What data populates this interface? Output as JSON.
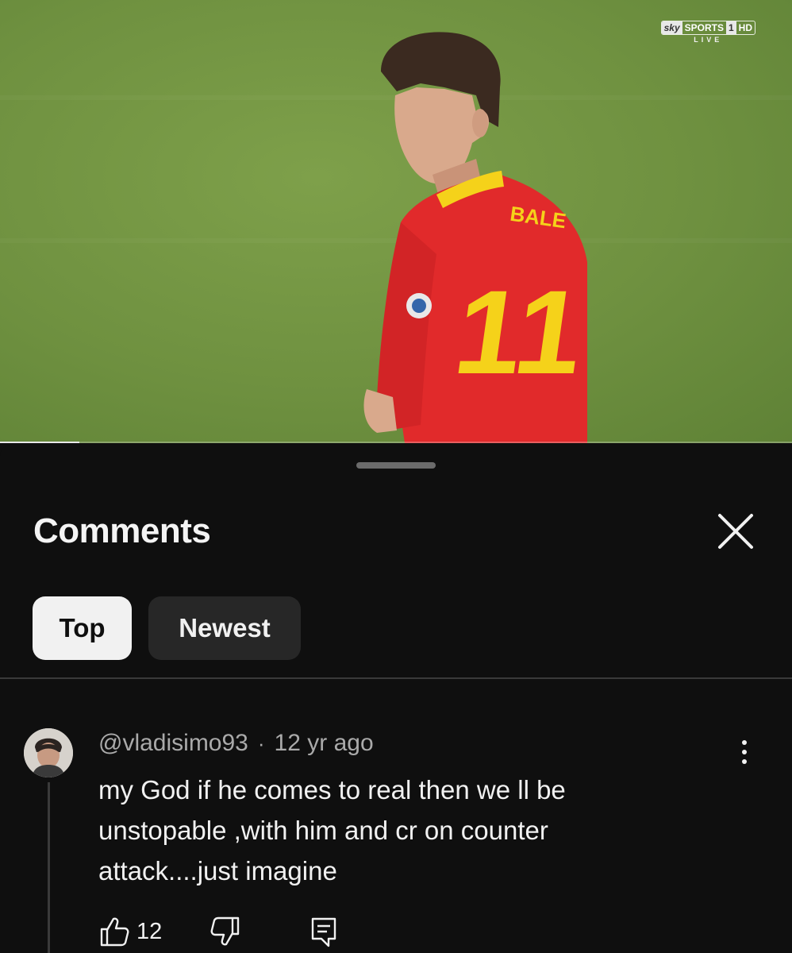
{
  "video": {
    "broadcaster": {
      "sky": "sky",
      "sports": "SPORTS",
      "channel": "1",
      "hd": "HD",
      "live": "LIVE"
    },
    "jersey": {
      "name": "BALE",
      "number": "11"
    },
    "progress_fraction": 0.1,
    "colors": {
      "grass": "#6f9140",
      "jersey": "#e12a2b",
      "jersey_trim": "#f5d21a"
    }
  },
  "comments_sheet": {
    "title": "Comments",
    "close_icon": "close-icon",
    "filters": [
      {
        "label": "Top",
        "active": true
      },
      {
        "label": "Newest",
        "active": false
      }
    ],
    "comments": [
      {
        "author": "@vladisimo93",
        "separator": "·",
        "time": "12 yr ago",
        "text": "my God if he comes to real then we ll be unstopable ,with him and cr on counter attack....just imagine",
        "likes": "12",
        "icons": [
          "like-icon",
          "dislike-icon",
          "reply-icon",
          "more-vertical-icon"
        ]
      }
    ]
  },
  "colors": {
    "background": "#0f0f0f",
    "chip_active": "#f1f1f1",
    "chip_inactive": "#272727",
    "secondary_text": "#aaaaaa"
  }
}
